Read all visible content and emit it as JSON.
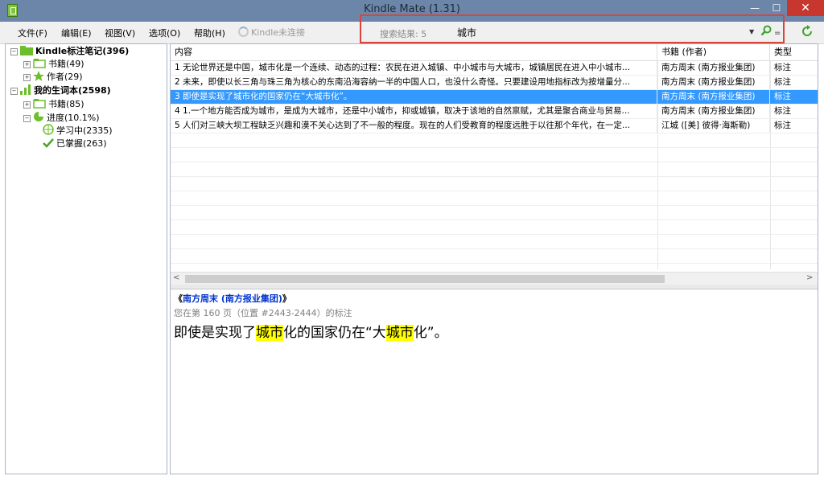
{
  "window": {
    "title": "Kindle Mate (1.31)",
    "min_icon": "—",
    "max_icon": "☐",
    "close_icon": "✕"
  },
  "menu": {
    "items": [
      "文件(F)",
      "编辑(E)",
      "视图(V)",
      "选项(O)",
      "帮助(H)"
    ],
    "kindle_status": "Kindle未连接"
  },
  "search": {
    "result_label": "搜索结果: 5",
    "query": "城市",
    "options_glyph": "="
  },
  "tree": {
    "notes_root": "Kindle标注笔记(396)",
    "notes_books": "书籍(49)",
    "notes_authors": "作者(29)",
    "vocab_root": "我的生词本(2598)",
    "vocab_books": "书籍(85)",
    "vocab_progress": "进度(10.1%)",
    "vocab_learning": "学习中(2335)",
    "vocab_mastered": "已掌握(263)"
  },
  "table": {
    "columns": [
      "内容",
      "书籍 (作者)",
      "类型"
    ],
    "rows": [
      {
        "content": "1 无论世界还是中国，城市化是一个连续、动态的过程：农民在进入城镇、中小城市与大城市，城镇居民在进入中小城市...",
        "book": "南方周末 (南方报业集团)",
        "type": "标注"
      },
      {
        "content": "2 未来，即使以长三角与珠三角为核心的东南沿海容纳一半的中国人口，也没什么奇怪。只要建设用地指标改为按增量分...",
        "book": "南方周末 (南方报业集团)",
        "type": "标注"
      },
      {
        "content": "3 即使是实现了城市化的国家仍在“大城市化”。",
        "book": "南方周末 (南方报业集团)",
        "type": "标注"
      },
      {
        "content": "4 1.一个地方能否成为城市，是成为大城市，还是中小城市，抑或城镇，取决于该地的自然禀赋，尤其是聚合商业与贸易...",
        "book": "南方周末 (南方报业集团)",
        "type": "标注"
      },
      {
        "content": "5 人们对三峡大坝工程缺乏兴趣和漠不关心达到了不一般的程度。现在的人们受教育的程度远胜于以往那个年代，在一定...",
        "book": "江城 ([美] 彼得·海斯勒)",
        "type": "标注"
      }
    ],
    "selected_index": 2
  },
  "scroll": {
    "left": "<",
    "right": ">"
  },
  "detail": {
    "book_open": "《",
    "book_title": "南方周末 (南方报业集团)",
    "book_close": "》",
    "location": "您在第 160 页（位置 #2443-2444）的标注",
    "text_parts": [
      "即使是实现了",
      "城市",
      "化的国家仍在“大",
      "城市",
      "化”。"
    ]
  },
  "colors": {
    "titlebar": "#6b86a8",
    "selection": "#3399ff",
    "highlight": "#ffff00",
    "search_border": "#d9443c",
    "tree_green": "#6cbf2a"
  }
}
